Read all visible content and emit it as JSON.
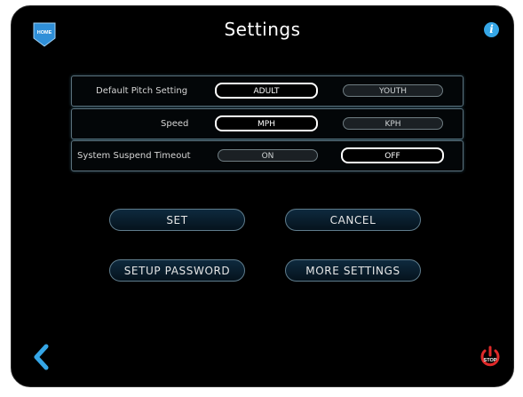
{
  "header": {
    "home_label": "HOME",
    "title": "Settings",
    "info_label": "i"
  },
  "settings": {
    "pitch": {
      "label": "Default Pitch Setting",
      "options": [
        "ADULT",
        "YOUTH"
      ],
      "selected": "ADULT"
    },
    "speed": {
      "label": "Speed",
      "options": [
        "MPH",
        "KPH"
      ],
      "selected": "MPH"
    },
    "suspend": {
      "label": "System Suspend Timeout",
      "options": [
        "ON",
        "OFF"
      ],
      "selected": "OFF"
    }
  },
  "actions": {
    "set": "SET",
    "cancel": "CANCEL",
    "setup_password": "SETUP PASSWORD",
    "more_settings": "MORE SETTINGS"
  },
  "footer": {
    "stop_label": "STOP"
  },
  "colors": {
    "accent_blue": "#35a6e6",
    "stop_red": "#e02a2a",
    "home_blue": "#2f8fd8"
  },
  "icons": {
    "home": "home-icon",
    "info": "info-icon",
    "back": "chevron-left-icon",
    "stop": "power-stop-icon"
  }
}
